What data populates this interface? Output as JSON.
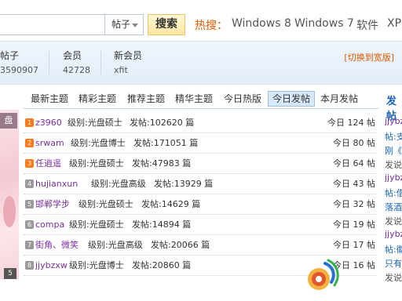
{
  "search": {
    "type_value": "帖子",
    "button_label": "搜索",
    "hot_label": "热搜：",
    "hot_links": [
      "Windows 8",
      "Windows 7",
      "软件",
      "XP"
    ]
  },
  "stats": {
    "items": [
      {
        "label": "帖子",
        "value": "3590907"
      },
      {
        "label": "会员",
        "value": "42728"
      },
      {
        "label": "新会员",
        "value": "xfit"
      }
    ],
    "switch_label": "[切换到宽版]"
  },
  "left_panel": {
    "tag": "盘",
    "pager": "5"
  },
  "tabs": [
    {
      "label": "最新主题",
      "active": false
    },
    {
      "label": "精彩主题",
      "active": false
    },
    {
      "label": "推荐主题",
      "active": false
    },
    {
      "label": "精华主题",
      "active": false
    },
    {
      "label": "今日热版",
      "active": false
    },
    {
      "label": "今日发帖",
      "active": true
    },
    {
      "label": "本月发帖",
      "active": false
    }
  ],
  "more_tab": "发帖",
  "posters": [
    {
      "rank": "1",
      "name": "z3960",
      "level": "级别:光盘硕士",
      "posts": "发帖:102620 篇",
      "today": "今日 124 帖",
      "rank_color": "#ff7a1a"
    },
    {
      "rank": "2",
      "name": "srwam",
      "level": "级别:光盘博士",
      "posts": "发帖:171051 篇",
      "today": "今日 80 帖",
      "rank_color": "#ff7a1a"
    },
    {
      "rank": "3",
      "name": "任逍遥",
      "level": "级别:光盘硕士",
      "posts": "发帖:47983 篇",
      "today": "今日 64 帖",
      "rank_color": "#ff7a1a"
    },
    {
      "rank": "4",
      "name": "hujianxun",
      "level": "级别:光盘高级",
      "posts": "发帖:13929 篇",
      "today": "今日 43 帖",
      "rank_color": "#999999"
    },
    {
      "rank": "5",
      "name": "邯郸学步",
      "level": "级别:光盘硕士",
      "posts": "发帖:14629 篇",
      "today": "今日 32 帖",
      "rank_color": "#999999"
    },
    {
      "rank": "6",
      "name": "compa",
      "level": "级别:光盘硕士",
      "posts": "发帖:14894 篇",
      "today": "今日 19 帖",
      "rank_color": "#999999"
    },
    {
      "rank": "7",
      "name": "街角、微笑",
      "level": "级别:光盘高级",
      "posts": "发帖:20066 篇",
      "today": "今日 17 帖",
      "rank_color": "#999999"
    },
    {
      "rank": "8",
      "name": "jjybzxw",
      "level": "级别:光盘博士",
      "posts": "发帖:20860 篇",
      "today": "今日 16 帖",
      "rank_color": "#999999"
    }
  ],
  "sidebar": [
    {
      "text": "jjybz",
      "style": "purple"
    },
    {
      "text": "帖:支",
      "style": "blue"
    },
    {
      "text": "刚《",
      "style": "blue"
    },
    {
      "text": "发说",
      "style": "gray"
    },
    {
      "text": "jjybz",
      "style": "purple"
    },
    {
      "text": "帖:借",
      "style": "blue"
    },
    {
      "text": "落酒",
      "style": "blue"
    },
    {
      "text": "发说",
      "style": "gray"
    },
    {
      "text": "jjybz",
      "style": "purple"
    },
    {
      "text": "帖:徽",
      "style": "blue"
    },
    {
      "text": "只有",
      "style": "blue"
    },
    {
      "text": "发说",
      "style": "gray"
    }
  ]
}
